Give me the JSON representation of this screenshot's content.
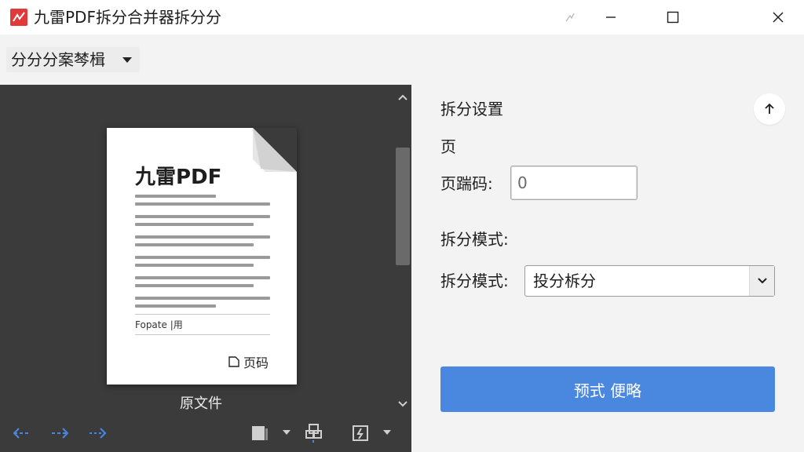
{
  "window": {
    "title": "九雷PDF拆分合并器拆分分",
    "controls": [
      "snap-icon",
      "minimize-icon",
      "maximize-icon",
      "close-icon"
    ]
  },
  "toolbar": {
    "mode_label": "分分分案棽楫"
  },
  "preview": {
    "doc_heading": "九雷PDF",
    "footer_label": "Fopate |用",
    "page_label": "页码",
    "caption": "原文件",
    "nav_icons": [
      "arrow-left-icon",
      "arrow-right-icon",
      "arrow-right-dashed-icon"
    ],
    "tool_icons": [
      "page-view-icon",
      "split-pages-icon",
      "rotate-icon"
    ]
  },
  "settings": {
    "section_title": "拆分设置",
    "sub_label": "页",
    "page_input_label": "页踹码:",
    "page_input_value": "0",
    "mode_heading": "拆分模式:",
    "mode_label": "拆分模式:",
    "mode_value": "投分柝分",
    "action_button": "预式 便略"
  },
  "colors": {
    "accent": "#4a88e0",
    "logo": "#e03a3a",
    "preview_bg": "#3b3b3b",
    "nav_arrow": "#4a88e0"
  }
}
